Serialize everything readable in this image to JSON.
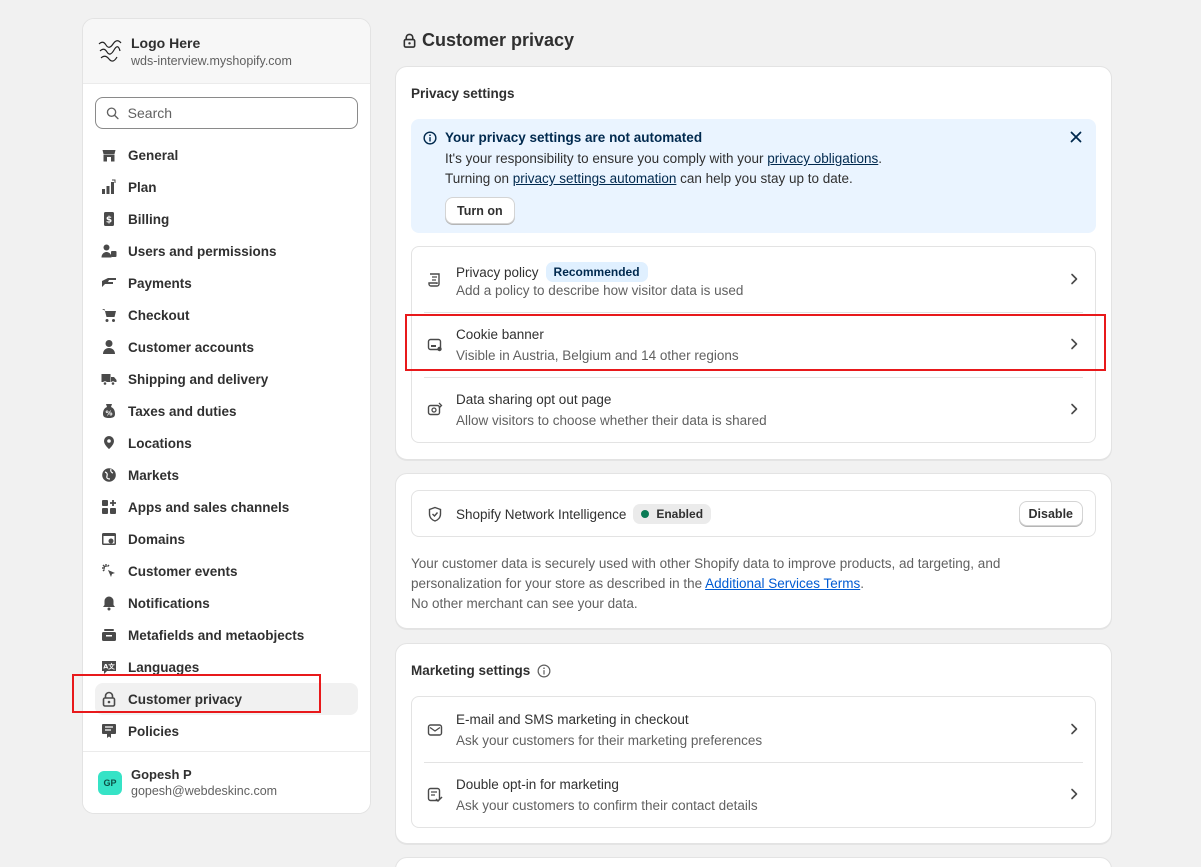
{
  "store": {
    "logo_text": "Logo Here",
    "name": "Logo Here",
    "url": "wds-interview.myshopify.com"
  },
  "search": {
    "placeholder": "Search"
  },
  "nav": [
    {
      "label": "General",
      "icon": "store-icon"
    },
    {
      "label": "Plan",
      "icon": "plan-icon"
    },
    {
      "label": "Billing",
      "icon": "billing-icon"
    },
    {
      "label": "Users and permissions",
      "icon": "users-icon"
    },
    {
      "label": "Payments",
      "icon": "payments-icon"
    },
    {
      "label": "Checkout",
      "icon": "cart-icon"
    },
    {
      "label": "Customer accounts",
      "icon": "person-icon"
    },
    {
      "label": "Shipping and delivery",
      "icon": "truck-icon"
    },
    {
      "label": "Taxes and duties",
      "icon": "tax-icon"
    },
    {
      "label": "Locations",
      "icon": "location-icon"
    },
    {
      "label": "Markets",
      "icon": "globe-icon"
    },
    {
      "label": "Apps and sales channels",
      "icon": "apps-icon"
    },
    {
      "label": "Domains",
      "icon": "domain-icon"
    },
    {
      "label": "Customer events",
      "icon": "events-icon"
    },
    {
      "label": "Notifications",
      "icon": "bell-icon"
    },
    {
      "label": "Metafields and metaobjects",
      "icon": "metafields-icon"
    },
    {
      "label": "Languages",
      "icon": "language-icon"
    },
    {
      "label": "Customer privacy",
      "icon": "lock-icon",
      "active": true
    },
    {
      "label": "Policies",
      "icon": "policies-icon"
    }
  ],
  "user": {
    "initials": "GP",
    "name": "Gopesh P",
    "email": "gopesh@webdeskinc.com"
  },
  "page": {
    "title": "Customer privacy"
  },
  "privacy": {
    "title": "Privacy settings",
    "banner": {
      "title": "Your privacy settings are not automated",
      "line1_pre": "It's your responsibility to ensure you comply with your ",
      "line1_link": "privacy obligations",
      "line1_post": ".",
      "line2_pre": "Turning on ",
      "line2_link": "privacy settings automation",
      "line2_post": " can help you stay up to date.",
      "button": "Turn on"
    },
    "rows": [
      {
        "title": "Privacy policy",
        "badge": "Recommended",
        "desc": "Add a policy to describe how visitor data is used",
        "icon": "policy-scroll-icon"
      },
      {
        "title": "Cookie banner",
        "desc": "Visible in Austria, Belgium and 14 other regions",
        "icon": "cookie-banner-icon"
      },
      {
        "title": "Data sharing opt out page",
        "desc": "Allow visitors to choose whether their data is shared",
        "icon": "data-sharing-icon"
      }
    ]
  },
  "network": {
    "title": "Shopify Network Intelligence",
    "badge": "Enabled",
    "button": "Disable",
    "text1": "Your customer data is securely used with other Shopify data to improve products, ad targeting, and",
    "text2_pre": "personalization for your store as described in the ",
    "text2_link": "Additional Services Terms",
    "text2_post": ".",
    "text3": "No other merchant can see your data."
  },
  "marketing": {
    "title": "Marketing settings",
    "rows": [
      {
        "title": "E-mail and SMS marketing in checkout",
        "desc": "Ask your customers for their marketing preferences",
        "icon": "email-icon"
      },
      {
        "title": "Double opt-in for marketing",
        "desc": "Ask your customers to confirm their contact details",
        "icon": "double-optin-icon"
      }
    ]
  },
  "colors": {
    "highlight": "#e8191b",
    "banner_bg": "#eaf4ff",
    "link": "#00294e",
    "success_dot": "#0a7b55",
    "avatar": "#36e3c6"
  }
}
